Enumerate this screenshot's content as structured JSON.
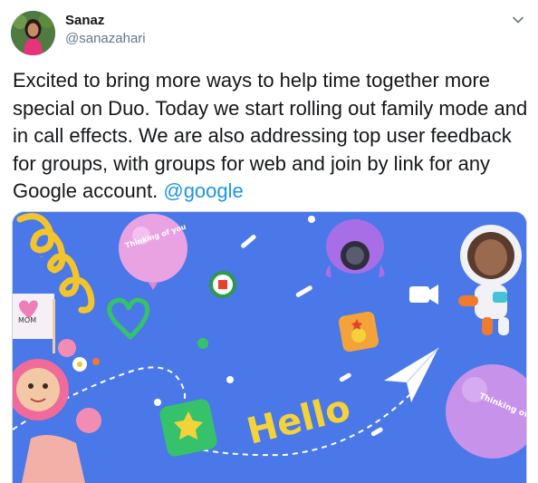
{
  "author": {
    "name": "Sanaz",
    "handle": "@sanazahari"
  },
  "tweet": {
    "text": "Excited to bring more ways to help time together more special on Duo. Today we start rolling out family mode and in call effects. We are also addressing top user feedback for groups, with groups for web and join by link for any Google account.",
    "mention": "@google"
  },
  "media": {
    "background_color": "#4a78e8",
    "script_text": "ello",
    "balloon_left_text": "Thinking of you",
    "balloon_right_text": "Thinking of you",
    "sign_text": "MOM",
    "hello_text": "Hello"
  },
  "icons": {
    "caret": "chevron-down-icon"
  }
}
